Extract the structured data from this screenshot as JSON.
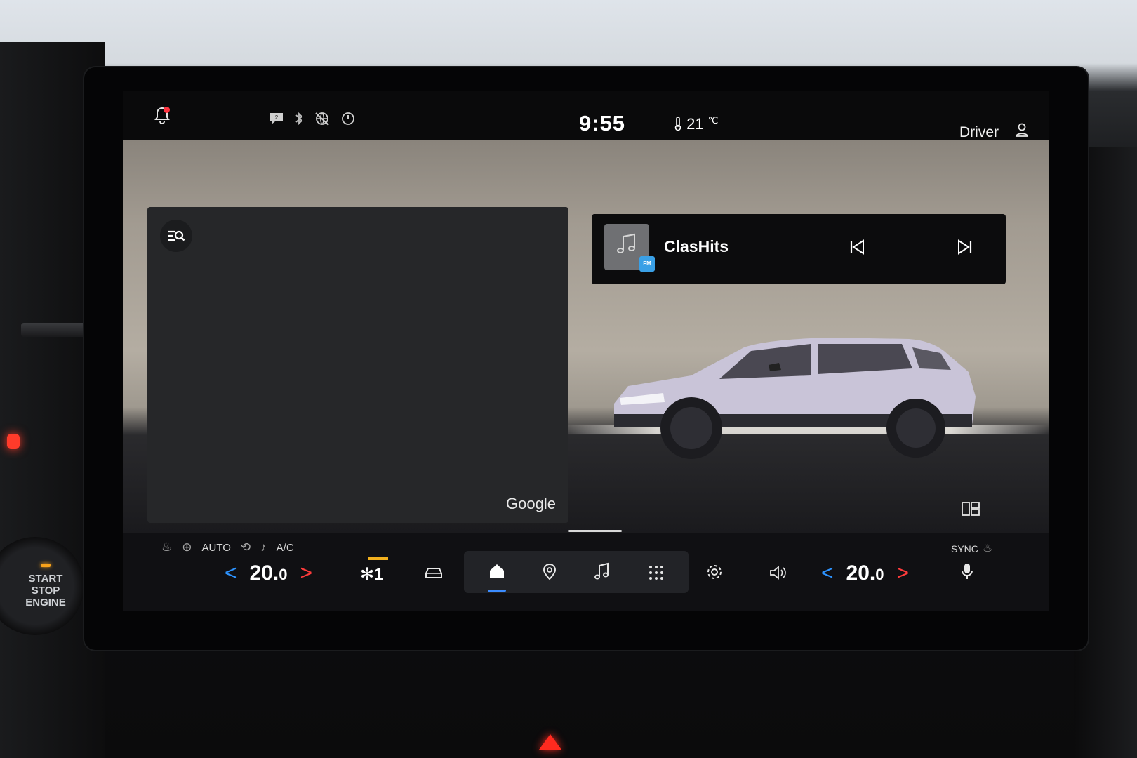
{
  "status": {
    "clock": "9:55",
    "temperature": "21",
    "temperature_unit": "℃",
    "user": "Driver",
    "message_count": "2"
  },
  "map": {
    "brand": "Google"
  },
  "media": {
    "track": "ClasHits",
    "source_badge": "FM"
  },
  "climate": {
    "auto_label": "AUTO",
    "ac_label": "A/C",
    "sync_label": "SYNC",
    "fan_level": "1",
    "left_temp_int": "20.",
    "left_temp_dec": "0",
    "right_temp_int": "20.",
    "right_temp_dec": "0"
  },
  "dash": {
    "start_line1": "START",
    "start_line2": "STOP",
    "start_line3": "ENGINE"
  },
  "icons": [
    "bell-icon",
    "message-icon",
    "bluetooth-icon",
    "no-network-icon",
    "power-icon",
    "thermometer-icon",
    "user-icon",
    "search-list-icon",
    "music-note-icon",
    "previous-track-icon",
    "next-track-icon",
    "layout-icon",
    "seat-heat-icon",
    "defrost-icon",
    "recirculation-icon",
    "airflow-icon",
    "fan-icon",
    "car-icon",
    "home-icon",
    "location-icon",
    "music-icon",
    "apps-grid-icon",
    "settings-icon",
    "volume-icon",
    "microphone-icon",
    "steering-heat-icon"
  ],
  "colors": {
    "accent_blue": "#2d93ff",
    "accent_red": "#ff3b3b",
    "fan_indicator": "#f2b01e",
    "notification": "#ff3340"
  }
}
